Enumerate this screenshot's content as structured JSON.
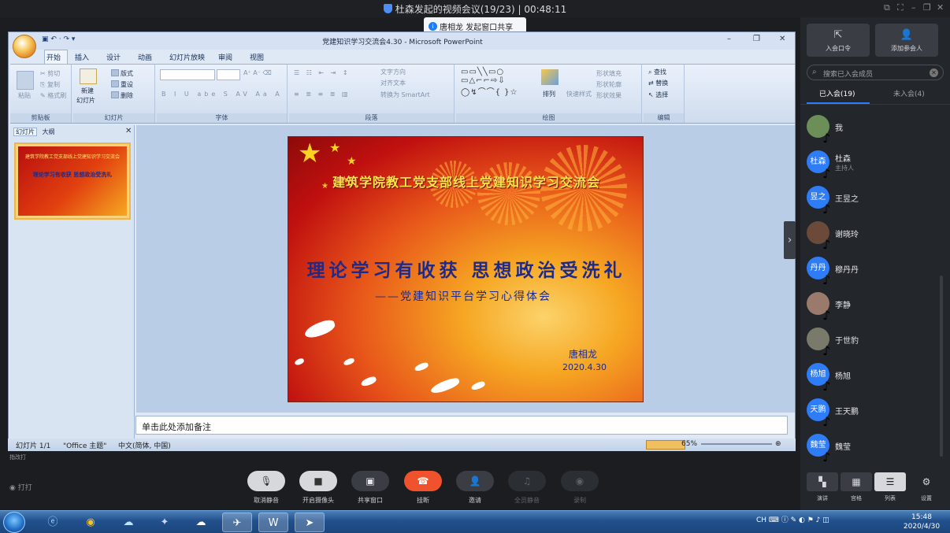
{
  "meeting": {
    "title": "杜森发起的视频会议(19/23) | 00:48:11",
    "toast": "唐相龙 发起窗口共享"
  },
  "powerpoint": {
    "window_title": "党建知识学习交流会4.30 - Microsoft PowerPoint",
    "tabs": [
      "开始",
      "插入",
      "设计",
      "动画",
      "幻灯片放映",
      "审阅",
      "视图"
    ],
    "ribbon": {
      "groups": [
        "剪贴板",
        "幻灯片",
        "字体",
        "段落",
        "绘图",
        "编辑"
      ],
      "clipboard": {
        "paste": "粘贴",
        "cut": "剪切",
        "copy": "复制",
        "format_painter": "格式刷"
      },
      "slides": {
        "new_slide": "新建",
        "new_slide2": "幻灯片",
        "layout": "版式",
        "reset": "重设",
        "delete": "删除"
      },
      "paragraph": {
        "text_direction": "文字方向",
        "align_text": "对齐文本",
        "smartart": "转换为 SmartArt"
      },
      "drawing": {
        "arrange": "排列",
        "quick_styles": "快速样式",
        "fill": "形状填充",
        "outline": "形状轮廓",
        "effects": "形状效果"
      },
      "editing": {
        "find": "查找",
        "replace": "替换",
        "select": "选择"
      }
    },
    "panel_tabs": [
      "幻灯片",
      "大纲"
    ],
    "slide": {
      "title": "建筑学院教工党支部线上党建知识学习交流会",
      "main": "理论学习有收获 思想政治受洗礼",
      "subtitle": "——党建知识平台学习心得体会",
      "author": "唐相龙",
      "date": "2020.4.30"
    },
    "thumb_title": "建筑学院教工党支部线上党建知识学习交流会",
    "thumb_main": "理论学习有收获 思想政治受洗礼",
    "notes_placeholder": "单击此处添加备注",
    "status": {
      "slide": "幻灯片 1/1",
      "theme": "\"Office 主题\"",
      "lang": "中文(简体, 中国)",
      "zoom": "65%"
    }
  },
  "tiny_label": "指改打",
  "side": {
    "invite_code": "入会口令",
    "add_member": "添加参会人",
    "search_placeholder": "搜索已入会成员",
    "tab_in": "已入会(19)",
    "tab_out": "未入会(4)",
    "members": [
      {
        "avatar": "",
        "name": "我",
        "role": "",
        "color": "#6c8f5a"
      },
      {
        "avatar": "杜森",
        "name": "杜森",
        "role": "主持人",
        "color": "#2e7cf6"
      },
      {
        "avatar": "昱之",
        "name": "王昱之",
        "role": "",
        "color": "#2e7cf6"
      },
      {
        "avatar": "",
        "name": "谢晓玲",
        "role": "",
        "color": "#6b4a3a"
      },
      {
        "avatar": "丹丹",
        "name": "穆丹丹",
        "role": "",
        "color": "#2e7cf6"
      },
      {
        "avatar": "",
        "name": "李静",
        "role": "",
        "color": "#9a7a6a"
      },
      {
        "avatar": "",
        "name": "于世豹",
        "role": "",
        "color": "#7a7a6a"
      },
      {
        "avatar": "杨旭",
        "name": "杨旭",
        "role": "",
        "color": "#2e7cf6"
      },
      {
        "avatar": "天鹏",
        "name": "王天鹏",
        "role": "",
        "color": "#2e7cf6"
      },
      {
        "avatar": "魏莹",
        "name": "魏莹",
        "role": "",
        "color": "#2e7cf6"
      }
    ]
  },
  "controls": [
    {
      "label": "取消静音",
      "icon": "mic-icon",
      "glyph": "🎙",
      "style": "light"
    },
    {
      "label": "开启摄像头",
      "icon": "camera-icon",
      "glyph": "■",
      "style": "light"
    },
    {
      "label": "共享窗口",
      "icon": "share-icon",
      "glyph": "▣",
      "style": "dark"
    },
    {
      "label": "挂断",
      "icon": "hangup-icon",
      "glyph": "☎",
      "style": "red"
    },
    {
      "label": "邀请",
      "icon": "invite-icon",
      "glyph": "👤",
      "style": "dark"
    },
    {
      "label": "全员静音",
      "icon": "mute-all-icon",
      "glyph": "♫",
      "style": "disabled"
    },
    {
      "label": "录制",
      "icon": "record-icon",
      "glyph": "◉",
      "style": "disabled"
    }
  ],
  "bottom_left": "打打",
  "views": [
    {
      "label": "演讲",
      "glyph": "▚"
    },
    {
      "label": "宫格",
      "glyph": "▦"
    },
    {
      "label": "列表",
      "glyph": "☰"
    },
    {
      "label": "设置",
      "glyph": "⚙"
    }
  ],
  "taskbar": {
    "lang": "CH",
    "time": "15:48",
    "date": "2020/4/30"
  }
}
